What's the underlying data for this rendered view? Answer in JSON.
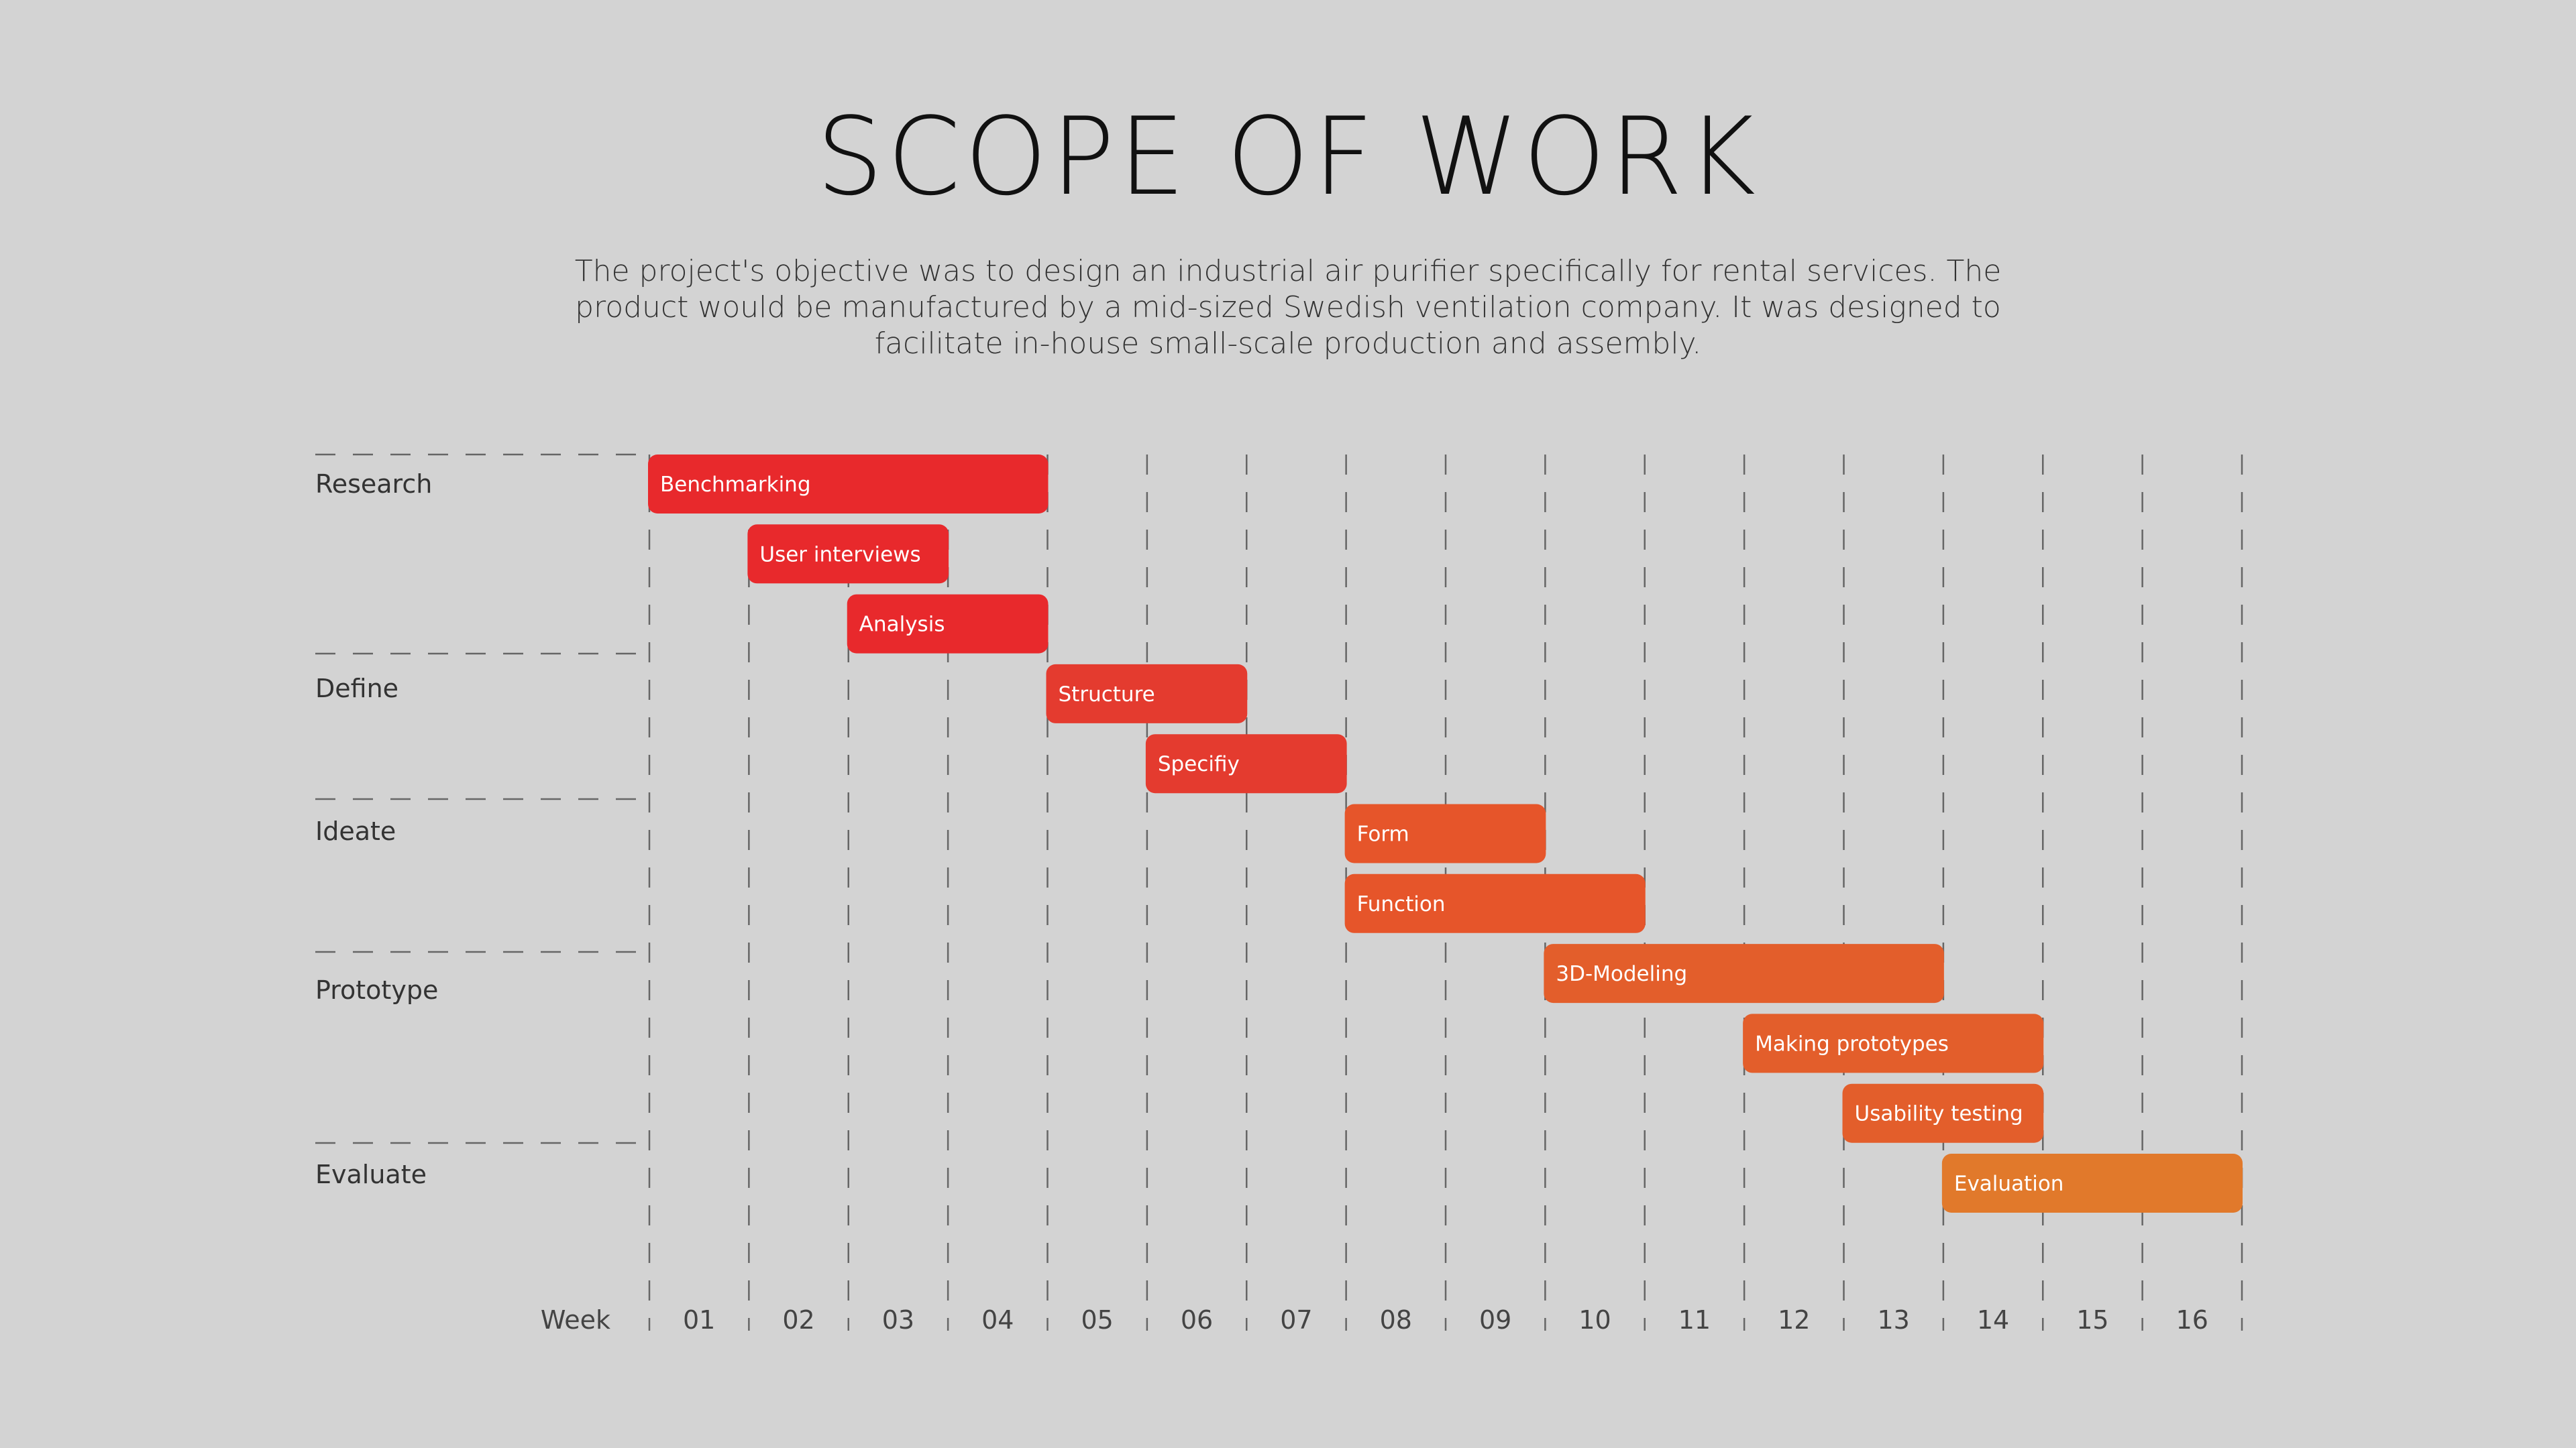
{
  "page": {
    "title": "SCOPE OF WORK",
    "description": "The project's objective was to design an industrial air purifier specifically for rental services. The product would be manufactured by a mid-sized Swedish ventilation company. It was designed to facilitate in-house small-scale production and assembly."
  },
  "chart_data": {
    "type": "gantt",
    "title": "SCOPE OF WORK",
    "xlabel": "Week",
    "x_ticks": [
      "01",
      "02",
      "03",
      "04",
      "05",
      "06",
      "07",
      "08",
      "09",
      "10",
      "11",
      "12",
      "13",
      "14",
      "15",
      "16"
    ],
    "x_range": [
      1,
      16
    ],
    "grid": "vertical dashed lines at week boundaries",
    "phases": [
      {
        "name": "Research",
        "tasks": [
          "Benchmarking",
          "User interviews",
          "Analysis"
        ]
      },
      {
        "name": "Define",
        "tasks": [
          "Structure",
          "Specifiy"
        ]
      },
      {
        "name": "Ideate",
        "tasks": [
          "Form",
          "Function"
        ]
      },
      {
        "name": "Prototype",
        "tasks": [
          "3D-Modeling",
          "Making prototypes",
          "Usability testing"
        ]
      },
      {
        "name": "Evaluate",
        "tasks": [
          "Evaluation"
        ]
      }
    ],
    "tasks": [
      {
        "name": "Benchmarking",
        "phase": "Research",
        "start_week": 1,
        "end_week": 4,
        "color": "#e8292c"
      },
      {
        "name": "User interviews",
        "phase": "Research",
        "start_week": 2,
        "end_week": 3,
        "color": "#e8292c"
      },
      {
        "name": "Analysis",
        "phase": "Research",
        "start_week": 3,
        "end_week": 4,
        "color": "#e8292c"
      },
      {
        "name": "Structure",
        "phase": "Define",
        "start_week": 5,
        "end_week": 6,
        "color": "#e43b2f"
      },
      {
        "name": "Specifiy",
        "phase": "Define",
        "start_week": 6,
        "end_week": 7,
        "color": "#e43b2f"
      },
      {
        "name": "Form",
        "phase": "Ideate",
        "start_week": 8,
        "end_week": 9,
        "color": "#e6552a"
      },
      {
        "name": "Function",
        "phase": "Ideate",
        "start_week": 8,
        "end_week": 10,
        "color": "#e6552a"
      },
      {
        "name": "3D-Modeling",
        "phase": "Prototype",
        "start_week": 10,
        "end_week": 13,
        "color": "#e35e2b"
      },
      {
        "name": "Making prototypes",
        "phase": "Prototype",
        "start_week": 12,
        "end_week": 14,
        "color": "#e35e2b"
      },
      {
        "name": "Usability testing",
        "phase": "Prototype",
        "start_week": 13,
        "end_week": 14,
        "color": "#e35e2b"
      },
      {
        "name": "Evaluation",
        "phase": "Evaluate",
        "start_week": 14,
        "end_week": 16,
        "color": "#e1792b"
      }
    ]
  }
}
